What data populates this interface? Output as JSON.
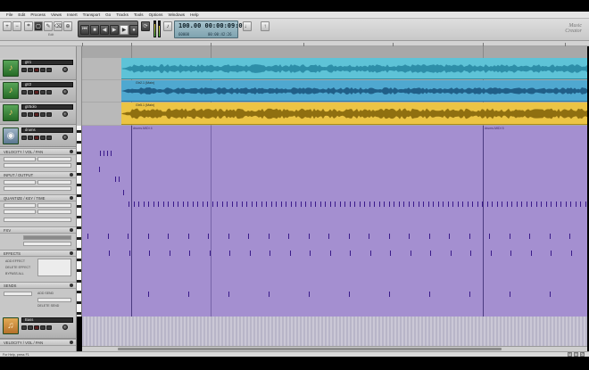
{
  "menu": {
    "app_label": "",
    "items": [
      "File",
      "Edit",
      "Process",
      "Views",
      "Insert",
      "Transport",
      "Go",
      "Tracks",
      "Tools",
      "Options",
      "Windows",
      "Help"
    ]
  },
  "toolbar": {
    "group_label_1": "",
    "group_label_2": "Edit",
    "time_main": "100.00  00:00:09:04",
    "time_sub_left": "60000",
    "time_sub_right": "00:00:42:26",
    "brand_line1": "Music",
    "brand_line2": "Creator"
  },
  "tracks": [
    {
      "name": "gtr1",
      "type": "guitar"
    },
    {
      "name": "gtr2",
      "type": "guitar"
    },
    {
      "name": "gtr5olo",
      "type": "guitar"
    },
    {
      "name": "drums",
      "type": "drums"
    },
    {
      "name": "Bass",
      "type": "bass"
    }
  ],
  "inspector": {
    "velocity": "VELOCITY / VOL / PAN",
    "input_output": "INPUT / OUTPUT",
    "quantize": "QUANTIZE / KEY / TIME",
    "fx": "FXV",
    "effects": "EFFECTS",
    "sends": "SENDS",
    "velocity2": "VELOCITY / VOL / PAN",
    "vol_field": "",
    "pan_field": "",
    "add_effect": "ADD EFFECT",
    "delete_effect": "DELETE EFFECT",
    "bypass_all": "BYPASS ALL",
    "add_send": "ADD SEND",
    "delete_send": "DELETE SEND"
  },
  "clips": {
    "gtr1": "",
    "gtr2": "Gtr2.1 (Main)",
    "gtr3": "Gtr5.1 (Main)",
    "midi_left": "drums.MIDI 4",
    "midi_right": "drums.MIDI 5"
  },
  "status": {
    "left": "For Help, press F1",
    "mid": "",
    "center": "",
    "right": ""
  },
  "colors": {
    "cyan_clip": "#5ec3d7",
    "blue_clip": "#4fa8d0",
    "yellow_clip": "#ecc444",
    "midi_bg": "#a48fd0",
    "note": "#3a1a8a"
  }
}
